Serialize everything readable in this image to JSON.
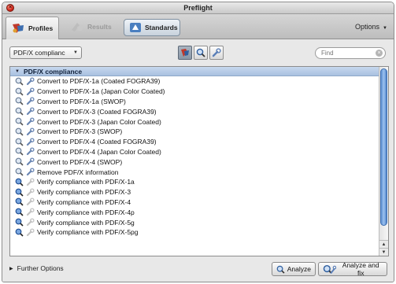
{
  "window": {
    "title": "Preflight"
  },
  "toolbar": {
    "tabs": [
      {
        "label": "Profiles",
        "icon": "profiles-icon"
      },
      {
        "label": "Results",
        "icon": "results-icon"
      },
      {
        "label": "Standards",
        "icon": "standards-icon"
      }
    ],
    "options_label": "Options"
  },
  "controls": {
    "filter_value": "PDF/X complianc",
    "find_placeholder": "Find"
  },
  "list": {
    "group": "PDF/X compliance",
    "items": [
      {
        "label": "Convert to PDF/X-1a (Coated FOGRA39)",
        "kind": "fixup"
      },
      {
        "label": "Convert to PDF/X-1a (Japan Color Coated)",
        "kind": "fixup"
      },
      {
        "label": "Convert to PDF/X-1a (SWOP)",
        "kind": "fixup"
      },
      {
        "label": "Convert to PDF/X-3 (Coated FOGRA39)",
        "kind": "fixup"
      },
      {
        "label": "Convert to PDF/X-3 (Japan Color Coated)",
        "kind": "fixup"
      },
      {
        "label": "Convert to PDF/X-3 (SWOP)",
        "kind": "fixup"
      },
      {
        "label": "Convert to PDF/X-4 (Coated FOGRA39)",
        "kind": "fixup"
      },
      {
        "label": "Convert to PDF/X-4 (Japan Color Coated)",
        "kind": "fixup"
      },
      {
        "label": "Convert to PDF/X-4 (SWOP)",
        "kind": "fixup"
      },
      {
        "label": "Remove PDF/X information",
        "kind": "fixup"
      },
      {
        "label": "Verify compliance with PDF/X-1a",
        "kind": "check"
      },
      {
        "label": "Verify compliance with PDF/X-3",
        "kind": "check"
      },
      {
        "label": "Verify compliance with PDF/X-4",
        "kind": "check"
      },
      {
        "label": "Verify compliance with PDF/X-4p",
        "kind": "check"
      },
      {
        "label": "Verify compliance with PDF/X-5g",
        "kind": "check"
      },
      {
        "label": "Verify compliance with PDF/X-5pg",
        "kind": "check"
      }
    ]
  },
  "footer": {
    "further_options": "Further Options",
    "analyze": "Analyze",
    "analyze_and_fix": "Analyze and fix"
  },
  "colors": {
    "selection_header": "#b7cce8",
    "scroll_thumb": "#6f9bd6",
    "close_button": "#d0261a"
  }
}
